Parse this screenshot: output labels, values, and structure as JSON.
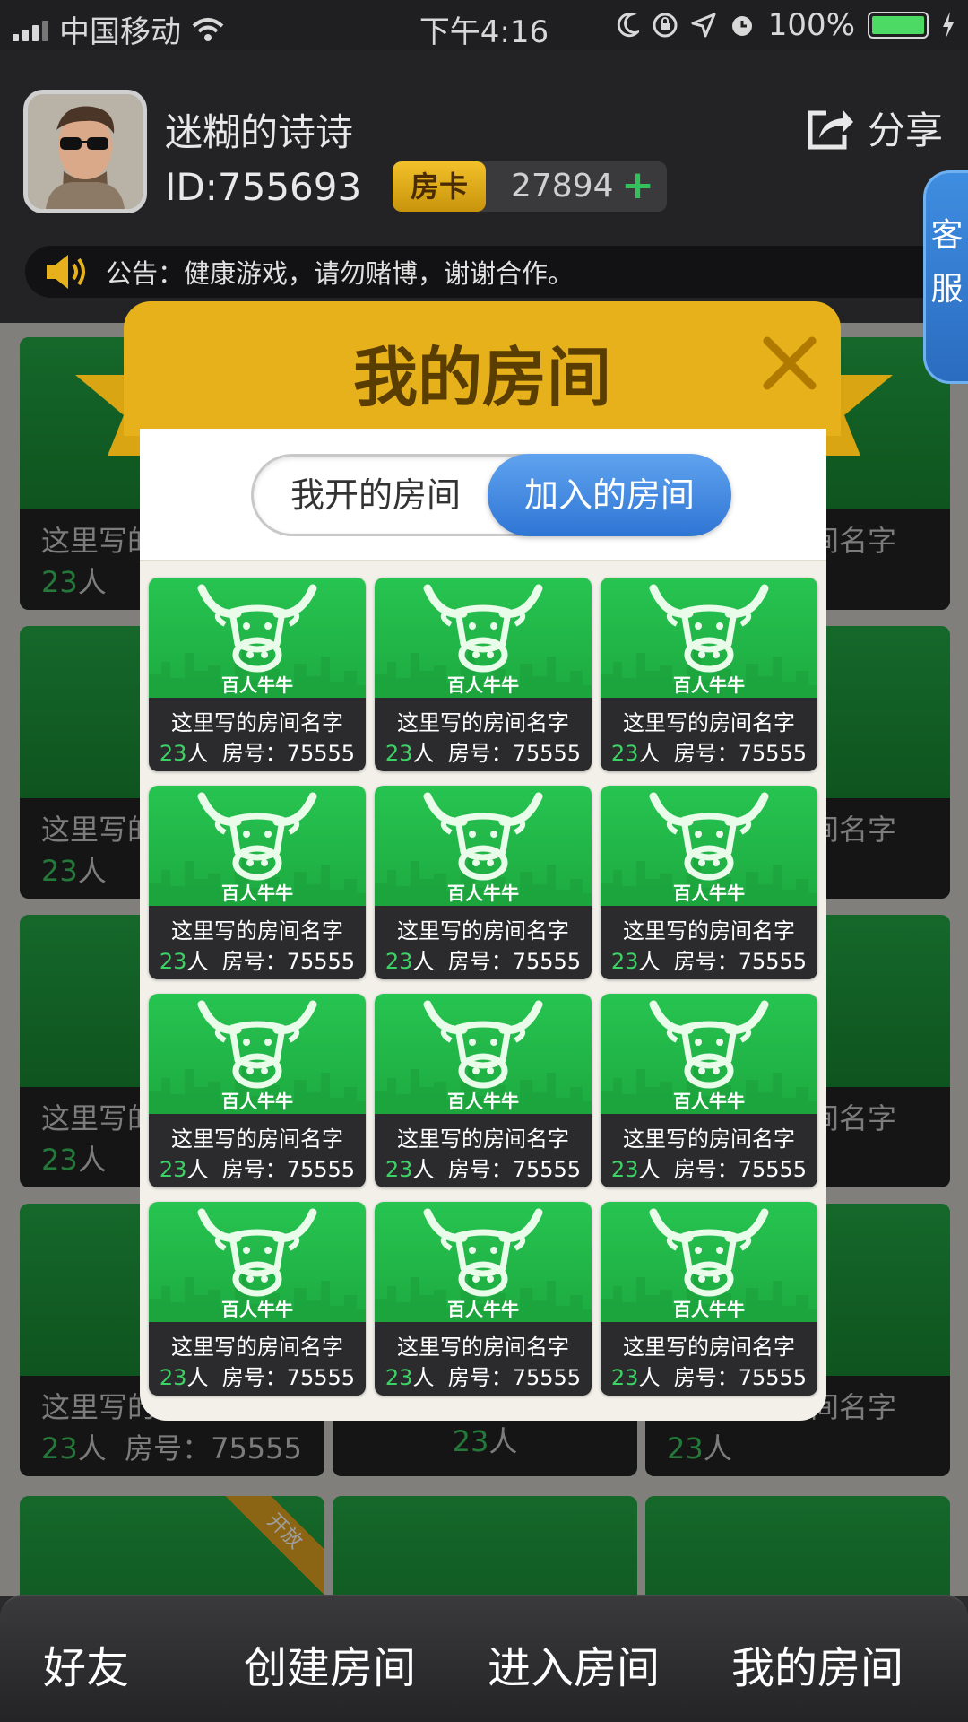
{
  "status_bar": {
    "carrier": "中国移动",
    "time": "下午4:16",
    "battery": "100%"
  },
  "header": {
    "username": "迷糊的诗诗",
    "user_id": "ID:755693",
    "room_card_label": "房卡",
    "room_card_count": "27894",
    "room_card_add": "+",
    "share_label": "分享",
    "notice": "公告：健康游戏，请勿赌博，谢谢合作。",
    "service_label": "客服"
  },
  "background": {
    "room_name": "这里写的房间名字",
    "count": "23",
    "person_unit": "人",
    "room_no": "房号：75555",
    "ribbon": "开放"
  },
  "modal": {
    "title": "我的房间",
    "tabs": [
      {
        "label": "我开的房间",
        "active": false
      },
      {
        "label": "加入的房间",
        "active": true
      }
    ],
    "rooms": [
      {
        "game": "百人牛牛",
        "name": "这里写的房间名字",
        "count": "23",
        "unit": "人",
        "room_no": "房号：75555"
      },
      {
        "game": "百人牛牛",
        "name": "这里写的房间名字",
        "count": "23",
        "unit": "人",
        "room_no": "房号：75555"
      },
      {
        "game": "百人牛牛",
        "name": "这里写的房间名字",
        "count": "23",
        "unit": "人",
        "room_no": "房号：75555"
      },
      {
        "game": "百人牛牛",
        "name": "这里写的房间名字",
        "count": "23",
        "unit": "人",
        "room_no": "房号：75555"
      },
      {
        "game": "百人牛牛",
        "name": "这里写的房间名字",
        "count": "23",
        "unit": "人",
        "room_no": "房号：75555"
      },
      {
        "game": "百人牛牛",
        "name": "这里写的房间名字",
        "count": "23",
        "unit": "人",
        "room_no": "房号：75555"
      },
      {
        "game": "百人牛牛",
        "name": "这里写的房间名字",
        "count": "23",
        "unit": "人",
        "room_no": "房号：75555"
      },
      {
        "game": "百人牛牛",
        "name": "这里写的房间名字",
        "count": "23",
        "unit": "人",
        "room_no": "房号：75555"
      },
      {
        "game": "百人牛牛",
        "name": "这里写的房间名字",
        "count": "23",
        "unit": "人",
        "room_no": "房号：75555"
      },
      {
        "game": "百人牛牛",
        "name": "这里写的房间名字",
        "count": "23",
        "unit": "人",
        "room_no": "房号：75555"
      },
      {
        "game": "百人牛牛",
        "name": "这里写的房间名字",
        "count": "23",
        "unit": "人",
        "room_no": "房号：75555"
      },
      {
        "game": "百人牛牛",
        "name": "这里写的房间名字",
        "count": "23",
        "unit": "人",
        "room_no": "房号：75555"
      }
    ]
  },
  "bottom_nav": {
    "items": [
      {
        "label": "好友"
      },
      {
        "label": "创建房间"
      },
      {
        "label": "进入房间"
      },
      {
        "label": "我的房间"
      }
    ]
  },
  "colors": {
    "accent_gold": "#e6b11a",
    "card_green": "#1daa40",
    "count_green": "#3dd265",
    "tab_blue": "#2f75d4",
    "service_blue": "#3f8de0"
  },
  "icons": [
    "wifi-icon",
    "moon-icon",
    "orientation-lock-icon",
    "location-icon",
    "alarm-icon",
    "share-icon",
    "speaker-icon",
    "close-icon",
    "bull-icon"
  ]
}
